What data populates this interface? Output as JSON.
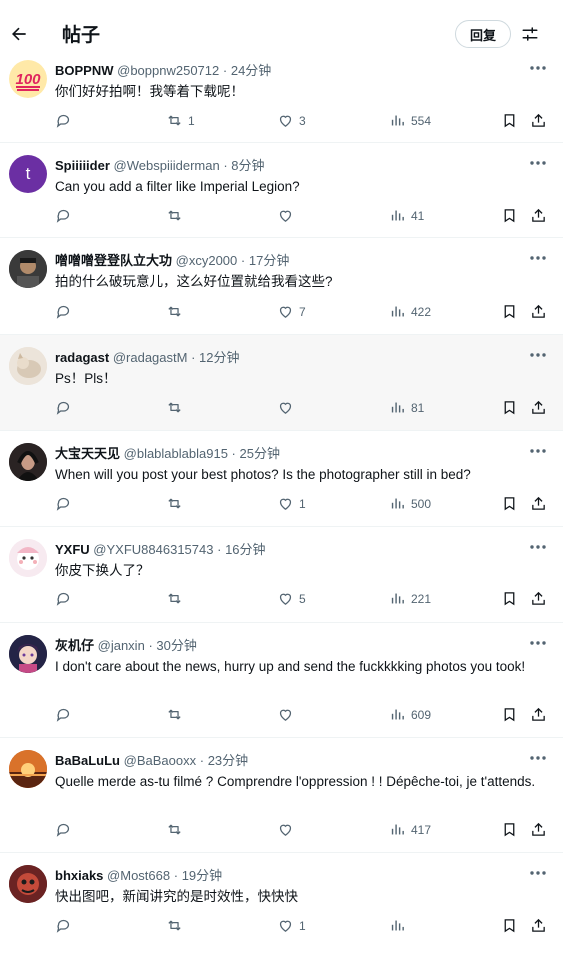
{
  "header": {
    "title": "帖子",
    "reply_label": "回复"
  },
  "tweets": [
    {
      "name": "BOPPNW",
      "handle": "@boppnw250712",
      "time": "24分钟",
      "text": "你们好好拍啊！我等着下载呢！",
      "retweets": "1",
      "likes": "3",
      "views": "554",
      "avatar_icon": "100-emoji-icon"
    },
    {
      "name": "Spiiiiider",
      "handle": "@Webspiiiderman",
      "time": "8分钟",
      "text": "Can you add a filter like Imperial Legion?",
      "retweets": "",
      "likes": "",
      "views": "41",
      "avatar_letter": "t"
    },
    {
      "name": "噌噌噌登登队立大功",
      "handle": "@xcy2000",
      "time": "17分钟",
      "text": "拍的什么破玩意儿，这么好位置就给我看这些?",
      "retweets": "",
      "likes": "7",
      "views": "422"
    },
    {
      "name": "radagast",
      "handle": "@radagastM",
      "time": "12分钟",
      "text": "Ps！Pls！",
      "retweets": "",
      "likes": "",
      "views": "81"
    },
    {
      "name": "大宝天天见",
      "handle": "@blablablabla915",
      "time": "25分钟",
      "text": "When will you post your best photos? Is the photographer still in bed?",
      "retweets": "",
      "likes": "1",
      "views": "500"
    },
    {
      "name": "YXFU",
      "handle": "@YXFU8846315743",
      "time": "16分钟",
      "text": "你皮下换人了？",
      "retweets": "",
      "likes": "5",
      "views": "221"
    },
    {
      "name": "灰机仔",
      "handle": "@janxin",
      "time": "30分钟",
      "text": "I don't care about the news, hurry up and send the fuckkkking photos you took!",
      "retweets": "",
      "likes": "",
      "views": "609"
    },
    {
      "name": "BaBaLuLu",
      "handle": "@BaBaooxx",
      "time": "23分钟",
      "text": "Quelle merde as-tu filmé ? Comprendre l'oppression ! ! Dépêche-toi, je t'attends.",
      "retweets": "",
      "likes": "",
      "views": "417"
    },
    {
      "name": "bhxiaks",
      "handle": "@Most668",
      "time": "19分钟",
      "text": "快出图吧，新闻讲究的是时效性，快快快",
      "retweets": "",
      "likes": "1",
      "views": ""
    }
  ],
  "colors": {
    "text": "#0f1419",
    "secondary": "#536471",
    "border": "#eff3f4",
    "spiiiiider_avatar": "#6b2fa3"
  }
}
